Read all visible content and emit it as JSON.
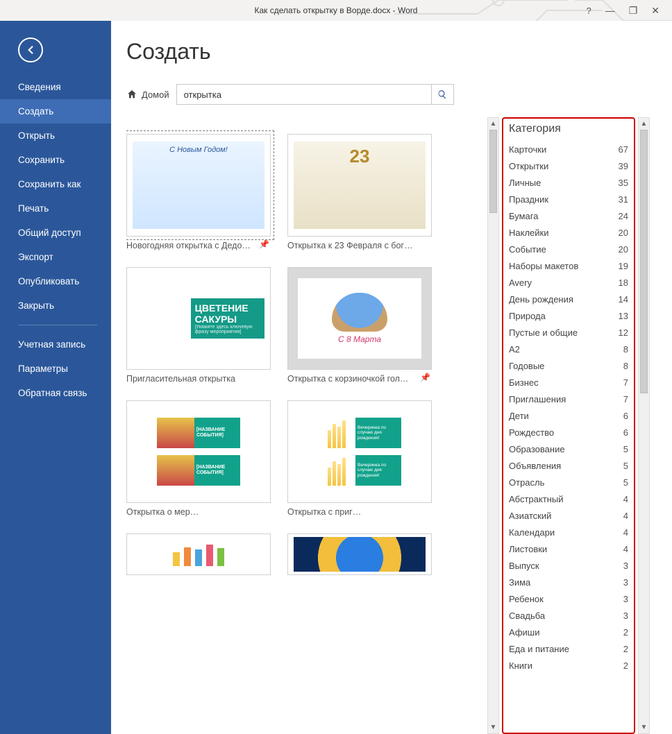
{
  "window": {
    "title": "Как сделать открытку в Ворде.docx - Word"
  },
  "titlebar": {
    "help": "?",
    "minimize": "—",
    "restore": "❐",
    "close": "✕"
  },
  "sidebar": {
    "items": [
      "Сведения",
      "Создать",
      "Открыть",
      "Сохранить",
      "Сохранить как",
      "Печать",
      "Общий доступ",
      "Экспорт",
      "Опубликовать",
      "Закрыть"
    ],
    "active_index": 1,
    "extra": [
      "Учетная запись",
      "Параметры",
      "Обратная связь"
    ]
  },
  "page": {
    "title": "Создать",
    "home": "Домой",
    "search_value": "открытка"
  },
  "templates": [
    {
      "caption": "Новогодняя открытка с Дедо…",
      "selected": true,
      "pin": true
    },
    {
      "caption": "Открытка к 23 Февраля с бог…",
      "selected": false,
      "pin": false
    },
    {
      "caption": "Пригласительная открытка",
      "selected": false,
      "pin": false
    },
    {
      "caption": "Открытка с корзиночкой гол…",
      "selected": false,
      "pin": true,
      "hover": true
    },
    {
      "caption": "Открытка о мер…",
      "selected": false,
      "pin": false
    },
    {
      "caption": "Открытка с приг…",
      "selected": false,
      "pin": false
    }
  ],
  "mini_labels": {
    "sakura_title": "ЦВЕТЕНИЕ САКУРЫ",
    "sakura_sub": "[Укажите здесь ключевую фразу мероприятия]",
    "march8": "С 8 Марта",
    "event_name": "[НАЗВАНИЕ СОБЫТИЯ]",
    "birthday_party": "Вечеринка по случаю дня рождения!",
    "feb23": "23"
  },
  "category": {
    "heading": "Категория",
    "items": [
      {
        "name": "Карточки",
        "count": 67
      },
      {
        "name": "Открытки",
        "count": 39
      },
      {
        "name": "Личные",
        "count": 35
      },
      {
        "name": "Праздник",
        "count": 31
      },
      {
        "name": "Бумага",
        "count": 24
      },
      {
        "name": "Наклейки",
        "count": 20
      },
      {
        "name": "Событие",
        "count": 20
      },
      {
        "name": "Наборы макетов",
        "count": 19
      },
      {
        "name": "Avery",
        "count": 18
      },
      {
        "name": "День рождения",
        "count": 14
      },
      {
        "name": "Природа",
        "count": 13
      },
      {
        "name": "Пустые и общие",
        "count": 12
      },
      {
        "name": "A2",
        "count": 8
      },
      {
        "name": "Годовые",
        "count": 8
      },
      {
        "name": "Бизнес",
        "count": 7
      },
      {
        "name": "Приглашения",
        "count": 7
      },
      {
        "name": "Дети",
        "count": 6
      },
      {
        "name": "Рождество",
        "count": 6
      },
      {
        "name": "Образование",
        "count": 5
      },
      {
        "name": "Объявления",
        "count": 5
      },
      {
        "name": "Отрасль",
        "count": 5
      },
      {
        "name": "Абстрактный",
        "count": 4
      },
      {
        "name": "Азиатский",
        "count": 4
      },
      {
        "name": "Календари",
        "count": 4
      },
      {
        "name": "Листовки",
        "count": 4
      },
      {
        "name": "Выпуск",
        "count": 3
      },
      {
        "name": "Зима",
        "count": 3
      },
      {
        "name": "Ребенок",
        "count": 3
      },
      {
        "name": "Свадьба",
        "count": 3
      },
      {
        "name": "Афиши",
        "count": 2
      },
      {
        "name": "Еда и питание",
        "count": 2
      },
      {
        "name": "Книги",
        "count": 2
      }
    ]
  }
}
